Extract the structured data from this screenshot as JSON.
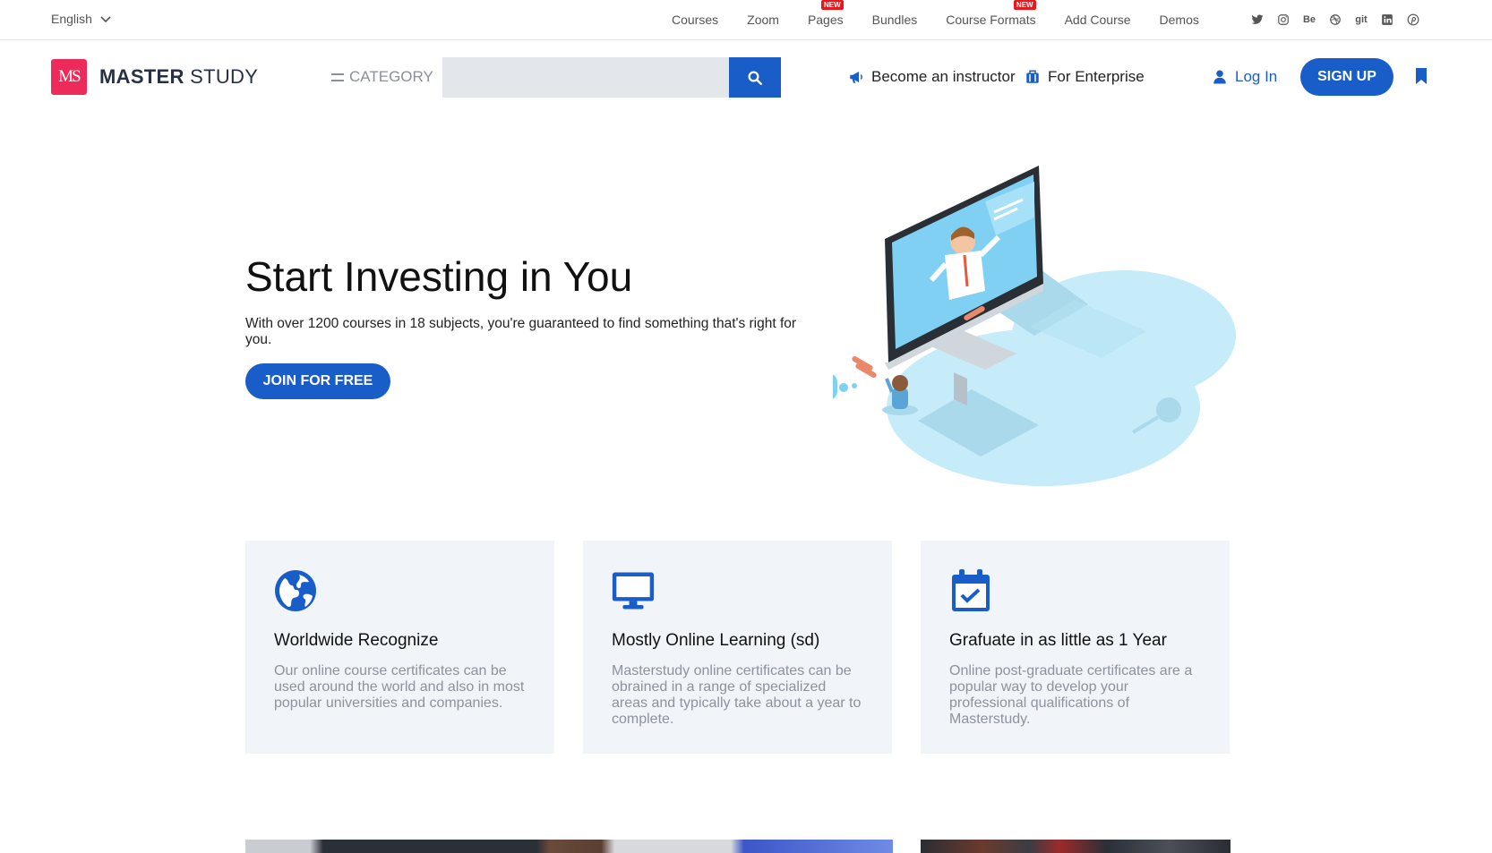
{
  "topbar": {
    "language": "English",
    "nav": [
      {
        "label": "Courses",
        "badge": ""
      },
      {
        "label": "Zoom",
        "badge": ""
      },
      {
        "label": "Pages",
        "badge": "NEW"
      },
      {
        "label": "Bundles",
        "badge": ""
      },
      {
        "label": "Course Formats",
        "badge": "NEW"
      },
      {
        "label": "Add Course",
        "badge": ""
      },
      {
        "label": "Demos",
        "badge": ""
      }
    ],
    "socials": [
      "twitter-icon",
      "instagram-icon",
      "Be",
      "dribbble-icon",
      "git",
      "linkedin-icon",
      "pinterest-icon"
    ],
    "social_text": {
      "behance": "Be",
      "git": "git"
    }
  },
  "header": {
    "logo_mark": "MS",
    "logo_bold": "MASTER",
    "logo_light": "STUDY",
    "category": "CATEGORY",
    "search_placeholder": "",
    "become_instructor": "Become an instructor",
    "for_enterprise": "For Enterprise",
    "login": "Log In",
    "signup": "SIGN UP"
  },
  "hero": {
    "title": "Start Investing in You",
    "subtitle": "With over 1200 courses in 18 subjects, you're guaranteed to find something that's right for you.",
    "cta": "JOIN FOR FREE"
  },
  "features": [
    {
      "icon": "globe-icon",
      "title": "Worldwide Recognize",
      "text": "Our online course certificates can be used around the world and also in most popular universities and companies."
    },
    {
      "icon": "monitor-icon",
      "title": "Mostly Online Learning (sd)",
      "text": "Masterstudy online certificates can be obrained in a range of specialized areas and typically take about a year to complete."
    },
    {
      "icon": "calendar-check-icon",
      "title": "Grafuate in as little as 1 Year",
      "text": "Online post-graduate certificates are a popular way to develop your professional qualifications of Masterstudy."
    }
  ],
  "colors": {
    "primary": "#195ec8",
    "brand": "#ee2a5b",
    "badge": "#e7171c",
    "card_bg": "#f1f4f8"
  }
}
